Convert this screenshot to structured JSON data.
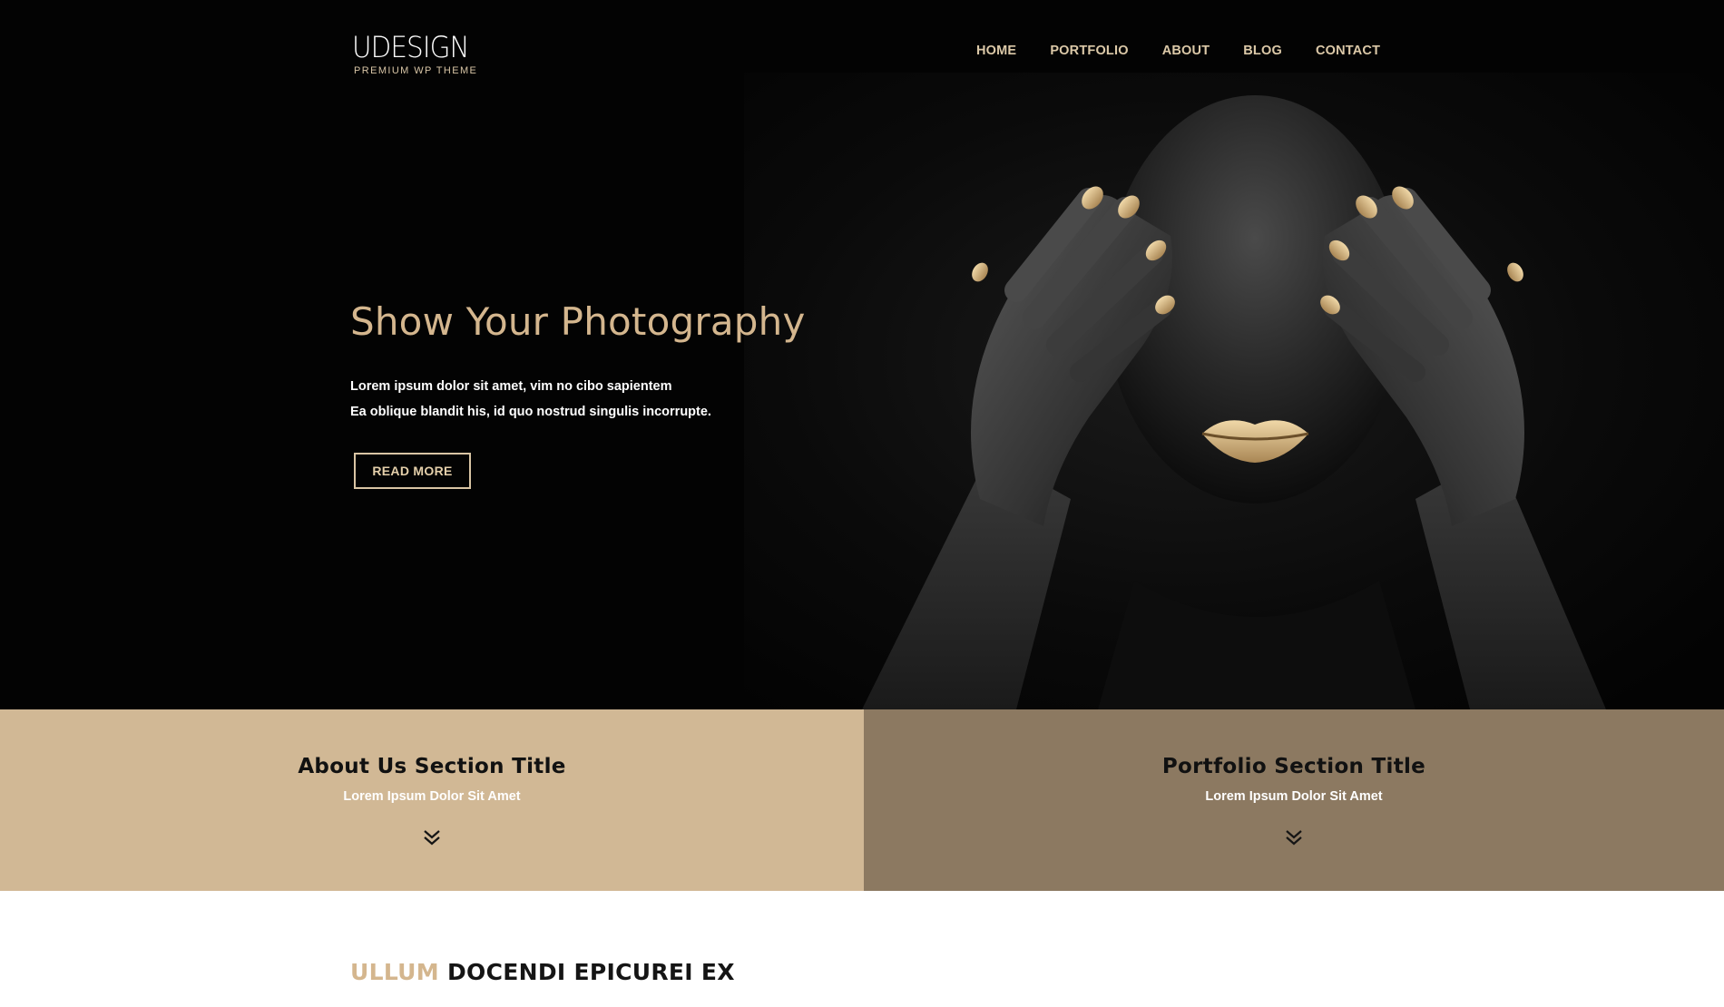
{
  "header": {
    "logo_main": "UDESIGN",
    "logo_sub": "PREMIUM WP THEME",
    "nav": [
      {
        "label": "HOME"
      },
      {
        "label": "PORTFOLIO"
      },
      {
        "label": "ABOUT"
      },
      {
        "label": "BLOG"
      },
      {
        "label": "CONTACT"
      }
    ]
  },
  "hero": {
    "title": "Show Your Photography",
    "line1": "Lorem ipsum dolor sit amet, vim no cibo sapientem",
    "line2": "Ea oblique blandit his, id quo nostrud singulis incorrupte.",
    "button_label": "READ MORE"
  },
  "sections": [
    {
      "title": "About Us Section Title",
      "subtitle": "Lorem Ipsum Dolor Sit Amet",
      "icon": "double-chevron-down-icon"
    },
    {
      "title": "Portfolio Section Title",
      "subtitle": "Lorem Ipsum Dolor Sit Amet",
      "icon": "double-chevron-down-icon"
    }
  ],
  "bottom": {
    "accent": "ULLUM",
    "rest": "DOCENDI EPICUREI EX"
  },
  "colors": {
    "hero_bg": "#030303",
    "accent_gold": "#d4b68e",
    "about_bg": "#d1b895",
    "portfolio_bg": "#8c7961"
  }
}
